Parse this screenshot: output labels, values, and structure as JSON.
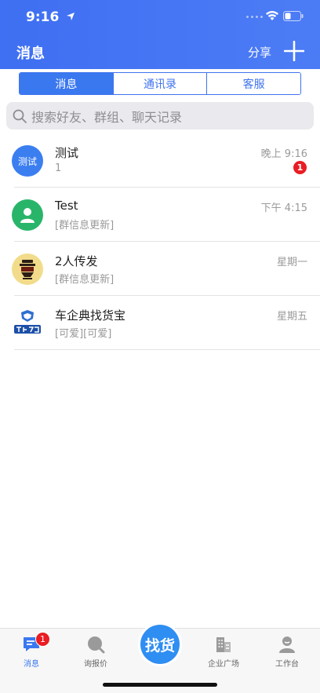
{
  "status_bar": {
    "time": "9:16"
  },
  "header": {
    "title": "消息",
    "share_label": "分享"
  },
  "tabs": [
    {
      "label": "消息",
      "active": true
    },
    {
      "label": "通讯录",
      "active": false
    },
    {
      "label": "客服",
      "active": false
    }
  ],
  "search": {
    "placeholder": "搜索好友、群组、聊天记录"
  },
  "conversations": [
    {
      "avatar_text": "测试",
      "name": "测试",
      "preview": "1",
      "time": "晚上 9:16",
      "unread": "1"
    },
    {
      "name": "Test",
      "preview": "[群信息更新]",
      "time": "下午 4:15"
    },
    {
      "name": "2人传发",
      "preview": "[群信息更新]",
      "time": "星期一"
    },
    {
      "name": "车企典找货宝",
      "preview": "[可爱][可爱]",
      "time": "星期五"
    }
  ],
  "tabbar": {
    "items": [
      {
        "label": "消息",
        "icon": "message-icon",
        "badge": "1",
        "active": true
      },
      {
        "label": "询报价",
        "icon": "inquiry-icon"
      },
      {
        "label": "找货",
        "icon": "find-goods-button"
      },
      {
        "label": "企业广场",
        "icon": "building-icon"
      },
      {
        "label": "工作台",
        "icon": "workbench-icon"
      }
    ]
  },
  "colors": {
    "primary": "#3a78f0",
    "badge": "#e91d23",
    "green": "#29b569"
  }
}
